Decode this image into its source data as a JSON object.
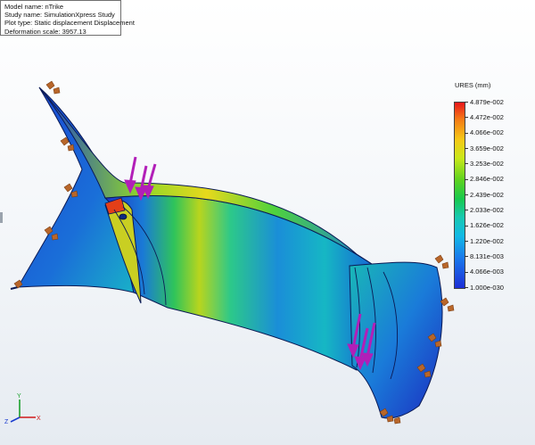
{
  "info": {
    "model_name": "Model name: nTrike",
    "study_name": "Study name: SimulationXpress Study",
    "plot_type": "Plot type: Static displacement Displacement",
    "deformation_scale": "Deformation scale: 3957.13"
  },
  "legend": {
    "title": "URES (mm)",
    "labels": [
      "4.879e-002",
      "4.472e-002",
      "4.066e-002",
      "3.659e-002",
      "3.253e-002",
      "2.846e-002",
      "2.439e-002",
      "2.033e-002",
      "1.626e-002",
      "1.220e-002",
      "8.131e-003",
      "4.066e-003",
      "1.000e-030"
    ],
    "colors": {
      "max": "#e8161b",
      "high": "#f6c917",
      "mid": "#18c94e",
      "low": "#12b9e6",
      "min": "#1d2fd6"
    }
  },
  "triad": {
    "x_label": "X",
    "y_label": "Y",
    "z_label": "Z"
  },
  "glyphs": {
    "load_arrow_color": "#b21fb8",
    "fixture_color": "#b8662a"
  }
}
